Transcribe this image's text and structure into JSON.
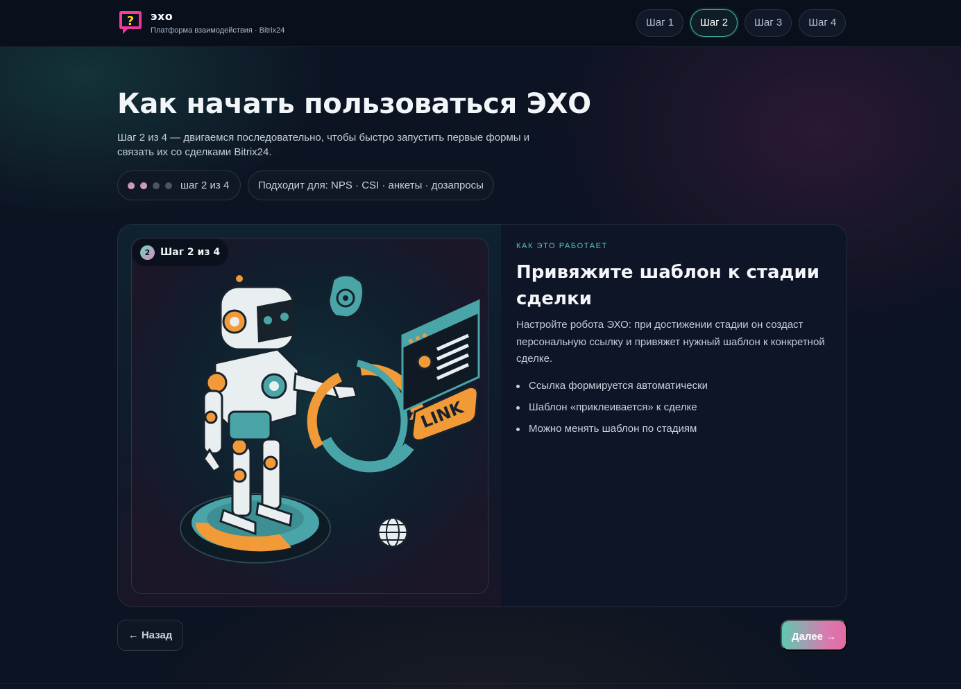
{
  "header": {
    "brand_name": "эхо",
    "brand_subtitle": "Платформа взаимодействия · Bitrix24",
    "logo_icon": "question-bubble-icon",
    "steps": [
      {
        "label": "Шаг 1",
        "active": false
      },
      {
        "label": "Шаг 2",
        "active": true
      },
      {
        "label": "Шаг 3",
        "active": false
      },
      {
        "label": "Шаг 4",
        "active": false
      }
    ]
  },
  "hero": {
    "title": "Как начать пользоваться ЭХО",
    "description": "Шаг 2 из 4 — двигаемся последовательно, чтобы быстро запустить первые формы и связать их со сделками Bitrix24.",
    "progress_label": "шаг 2 из 4",
    "progress_current": 2,
    "progress_total": 4,
    "suits_label": "Подходит для: NPS · CSI · анкеты · дозапросы"
  },
  "card": {
    "badge_number": "2",
    "badge_label": "Шаг 2 из 4",
    "illustration_text": "LINK",
    "kicker": "КАК ЭТО РАБОТАЕТ",
    "title": "Привяжите шаблон к стадии сделки",
    "description": "Настройте робота ЭХО: при достижении стадии он создаст персональную ссылку и привяжет нужный шаблон к конкретной сделке.",
    "bullets": [
      "Ссылка формируется автоматически",
      "Шаблон «приклеивается» к сделке",
      "Можно менять шаблон по стадиям"
    ]
  },
  "nav": {
    "back_label": "← Назад",
    "next_label": "Далее →"
  },
  "colors": {
    "accent_teal": "#5fc9b0",
    "accent_pink": "#e26aa6",
    "accent_orange": "#f29a38",
    "background": "#0b1120"
  }
}
